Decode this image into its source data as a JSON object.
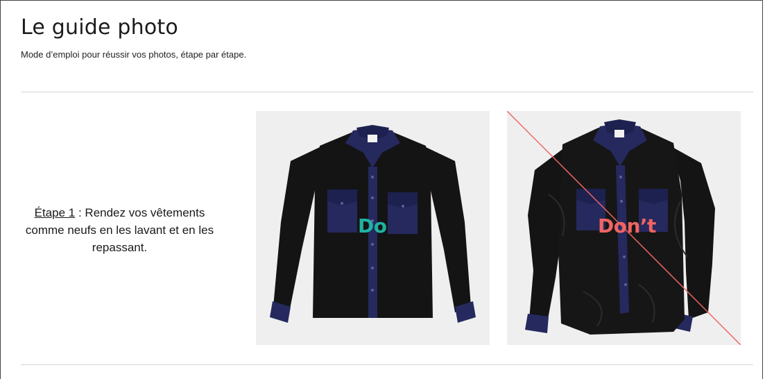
{
  "guide": {
    "title": "Le guide photo",
    "subtitle": "Mode d’emploi pour réussir vos photos, étape par étape."
  },
  "step1": {
    "label": "Étape 1",
    "text": " : Rendez vos vêtements comme neufs en les lavant et en les repassant."
  },
  "examples": {
    "do_label": "Do",
    "dont_label": "Don’t"
  },
  "colors": {
    "do_accent": "#20b2a0",
    "dont_accent": "#f06464",
    "shirt_body": "#141414",
    "shirt_trim": "#25295e",
    "photo_bg": "#efefef"
  },
  "icons": {
    "do_photo": "shirt-flat-pressed",
    "dont_photo": "shirt-wrinkled-crossed-out"
  }
}
